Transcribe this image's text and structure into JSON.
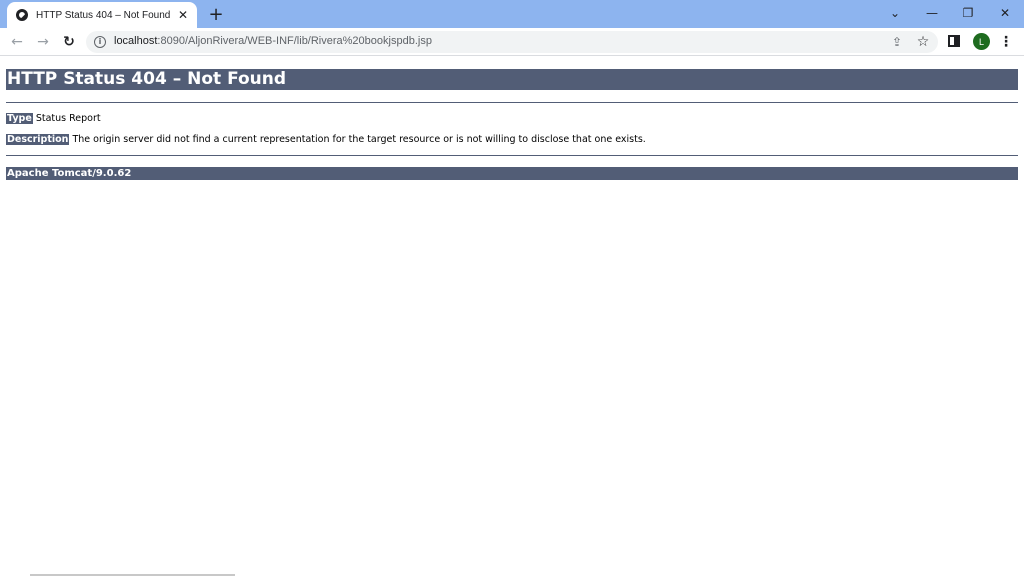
{
  "browser": {
    "tab": {
      "title": "HTTP Status 404 – Not Found",
      "favicon": "globe-icon",
      "close_glyph": "✕"
    },
    "new_tab_glyph": "+",
    "window_controls": {
      "tab_search": "⌄",
      "minimize": "—",
      "restore": "❐",
      "close": "✕"
    },
    "toolbar": {
      "back": "←",
      "forward": "→",
      "reload": "↻",
      "url_host": "localhost",
      "url_rest": ":8090/AljonRivera/WEB-INF/lib/Rivera%20bookjspdb.jsp",
      "share_icon": "⇪",
      "bookmark_icon": "☆",
      "profile_initial": "L",
      "menu_icon": "⋮"
    },
    "colors": {
      "tabstrip": "#8db4ef",
      "tomcat_header": "#525d76",
      "avatar": "#1e6b1f"
    }
  },
  "page": {
    "title": "HTTP Status 404 – Not Found",
    "type_label": "Type",
    "type_value": "Status Report",
    "description_label": "Description",
    "description_value": "The origin server did not find a current representation for the target resource or is not willing to disclose that one exists.",
    "server": "Apache Tomcat/9.0.62"
  }
}
